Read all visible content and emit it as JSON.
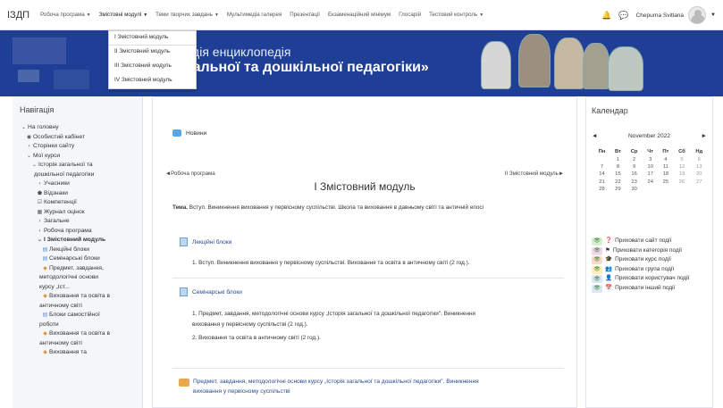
{
  "topnav": {
    "brand": "ІЗДП",
    "items": [
      {
        "label": "Робоча програма",
        "caret": true
      },
      {
        "label": "Змістовні модулі",
        "caret": true
      },
      {
        "label": "Теми творчих завдань",
        "caret": true
      },
      {
        "label": "Мультимедіа галерея",
        "caret": false
      },
      {
        "label": "Презентації",
        "caret": false
      },
      {
        "label": "Екзаменаційний мінімум",
        "caret": false
      },
      {
        "label": "Глосарій",
        "caret": false
      },
      {
        "label": "Тестовий контроль",
        "caret": true
      }
    ],
    "username": "Chepurna Svitlana"
  },
  "dropdown": {
    "items": [
      "І Змістовний модуль",
      "ІІ Змістовний модуль",
      "ІІІ Змістовний модуль",
      "ІV Змістовний модуль"
    ]
  },
  "banner": {
    "line1": "педія енциклопедія",
    "line2": "агальної та дошкільної педагогіки»"
  },
  "left": {
    "title": "Навігація",
    "tree": [
      {
        "indent": 0,
        "icon": "v",
        "label": "На головну"
      },
      {
        "indent": 1,
        "icon": "dashboard",
        "label": "Особистий кабінет"
      },
      {
        "indent": 1,
        "icon": ">",
        "label": "Сторінки сайту"
      },
      {
        "indent": 1,
        "icon": "v",
        "label": "Мої курси"
      },
      {
        "indent": 2,
        "icon": "v",
        "label": "Історія загальної та"
      },
      {
        "indent": 2,
        "icon": "",
        "label": "дошкільної педагогіки"
      },
      {
        "indent": 3,
        "icon": ">",
        "label": "Учасники"
      },
      {
        "indent": 3,
        "icon": "badge",
        "label": "Відзнаки"
      },
      {
        "indent": 3,
        "icon": "check",
        "label": "Компетенції"
      },
      {
        "indent": 3,
        "icon": "grid",
        "label": "Журнал оцінок"
      },
      {
        "indent": 3,
        "icon": ">",
        "label": "Загальне"
      },
      {
        "indent": 3,
        "icon": ">",
        "label": "Робоча програма"
      },
      {
        "indent": 3,
        "icon": "v",
        "label": "І Змістовний модуль",
        "bold": true
      },
      {
        "indent": 4,
        "icon": "page",
        "label": "Лекційні блоки"
      },
      {
        "indent": 4,
        "icon": "page",
        "label": "Семінарські блоки"
      },
      {
        "indent": 4,
        "icon": "res",
        "label": "Предмет, завдання,"
      },
      {
        "indent": 3,
        "icon": "",
        "label": "методологічні основи"
      },
      {
        "indent": 3,
        "icon": "",
        "label": "курсу „Іст..."
      },
      {
        "indent": 4,
        "icon": "res",
        "label": "Виховання та освіта в"
      },
      {
        "indent": 3,
        "icon": "",
        "label": "античному світі"
      },
      {
        "indent": 4,
        "icon": "page",
        "label": "Блоки самостійної"
      },
      {
        "indent": 3,
        "icon": "",
        "label": "роботи"
      },
      {
        "indent": 4,
        "icon": "res",
        "label": "Виховання та освіта в"
      },
      {
        "indent": 3,
        "icon": "",
        "label": "античному світі"
      },
      {
        "indent": 4,
        "icon": "res",
        "label": "Виховання та"
      }
    ]
  },
  "main": {
    "news": "Новини",
    "prev": "◄Робоча програма",
    "next": "ІІ Змістовний модуль►",
    "section_title": "І Змістовний модуль",
    "theme_label": "Тема.",
    "theme_text": " Вступ. Виникнення виховання у  первісному суспільстві. Школа та виховання в давньому світі та античній епосі",
    "lectures_title": "Лекційні блоки",
    "lectures_item": "1. Вступ. Виникнення виховання у первісному  суспільстві.  Виховання  та освіта в античному світі (2 год.).",
    "seminars_title": "Семінарські блоки",
    "seminars_item1_line1": "1. Предмет, завдання, методологічні основи курсу „Історія загальної та дошкільної педагогіки\". Виникнення",
    "seminars_item1_line2": "виховання у первісному суспільстві (2 год.).",
    "seminars_item2": "2. Виховання та освіта в античному  світі (2 год.).",
    "resource_line1": "Предмет, завдання, методологічні основи курсу „Історія загальної та дошкільної педагогіки\". Виникнення",
    "resource_line2": "виховання у первісному суспільстві"
  },
  "right": {
    "title": "Календар",
    "month": "November 2022",
    "prev": "◄",
    "next": "►",
    "weekdays": [
      "Пн",
      "Вт",
      "Ср",
      "Чт",
      "Пт",
      "Сб",
      "Нд"
    ],
    "weeks": [
      [
        "",
        "1",
        "2",
        "3",
        "4",
        "5",
        "6"
      ],
      [
        "7",
        "8",
        "9",
        "10",
        "11",
        "12",
        "13"
      ],
      [
        "14",
        "15",
        "16",
        "17",
        "18",
        "19",
        "20"
      ],
      [
        "21",
        "22",
        "23",
        "24",
        "25",
        "26",
        "27"
      ],
      [
        "28",
        "29",
        "30",
        "",
        "",
        "",
        ""
      ]
    ],
    "events": [
      {
        "color": "#d7f0d2",
        "sym": "❓",
        "label": "Приховати сайт події"
      },
      {
        "color": "#f2d6ea",
        "sym": "⚑",
        "label": "Приховати категорія події"
      },
      {
        "color": "#fbd9c4",
        "sym": "🎓",
        "label": "Приховати курс події"
      },
      {
        "color": "#fff0b8",
        "sym": "👥",
        "label": "Приховати група події"
      },
      {
        "color": "#dbe7f6",
        "sym": "👤",
        "label": "Приховати користувач події"
      },
      {
        "color": "#dbe7f6",
        "sym": "📅",
        "label": "Приховати інший події"
      }
    ]
  }
}
